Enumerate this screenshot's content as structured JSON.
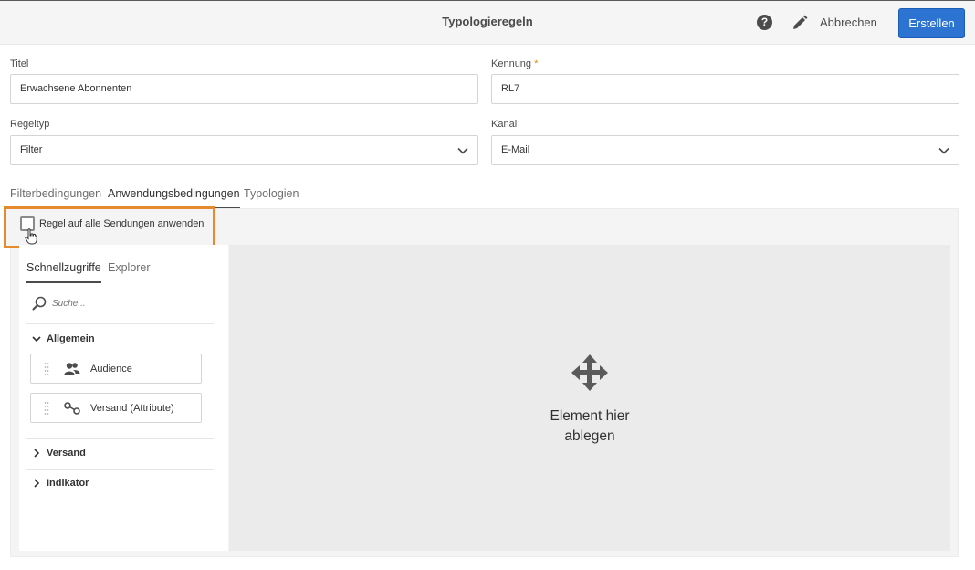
{
  "header": {
    "title": "Typologieregeln",
    "cancel_label": "Abbrechen",
    "create_label": "Erstellen",
    "help_glyph": "?"
  },
  "form": {
    "titel": {
      "label": "Titel",
      "value": "Erwachsene Abonnenten"
    },
    "kennung": {
      "label": "Kennung",
      "required_mark": "*",
      "value": "RL7"
    },
    "regeltyp": {
      "label": "Regeltyp",
      "selected": "Filter"
    },
    "kanal": {
      "label": "Kanal",
      "selected": "E-Mail"
    }
  },
  "tabs": [
    "Filterbedingungen",
    "Anwendungsbedingungen",
    "Typologien"
  ],
  "active_tab": "Anwendungsbedingungen",
  "apply_all": {
    "label": "Regel auf alle Sendungen anwenden",
    "checked": false
  },
  "palette": {
    "tabs": [
      "Schnellzugriffe",
      "Explorer"
    ],
    "search_placeholder": "Suche...",
    "sections": {
      "allgemein": "Allgemein",
      "versand": "Versand",
      "indikator": "Indikator"
    },
    "items": {
      "audience": "Audience",
      "versand_attribute": "Versand (Attribute)"
    }
  },
  "dropzone": {
    "line1": "Element hier",
    "line2": "ablegen"
  },
  "colors": {
    "accent": "#2d73d2",
    "highlight": "#e68a2e",
    "required": "#e68619"
  },
  "icons": [
    "help-icon",
    "pencil-icon",
    "chevron-down-icon",
    "search-icon",
    "chevron-right-icon",
    "drag-handle-icon",
    "audience-icon",
    "link-icon",
    "move-icon",
    "cursor-hand-icon"
  ]
}
